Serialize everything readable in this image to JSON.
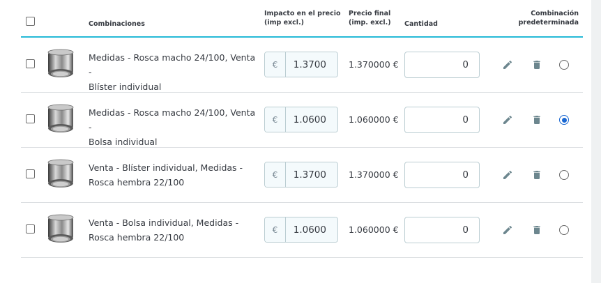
{
  "header": {
    "combinations": "Combinaciones",
    "impact_line1": "Impacto en el precio",
    "impact_line2": "(imp excl.)",
    "final_line1": "Precio final",
    "final_line2": "(imp. excl.)",
    "quantity": "Cantidad",
    "default_line1": "Combinación",
    "default_line2": "predeterminada"
  },
  "rows": [
    {
      "name_line1": "Medidas - Rosca macho 24/100, Venta -",
      "name_line2": "Blíster individual",
      "currency": "€",
      "impact": "1.3700",
      "final_price": "1.370000 €",
      "quantity": "0",
      "is_default": false,
      "image": "male-thread-aerator"
    },
    {
      "name_line1": "Medidas - Rosca macho 24/100, Venta -",
      "name_line2": "Bolsa individual",
      "currency": "€",
      "impact": "1.0600",
      "final_price": "1.060000 €",
      "quantity": "0",
      "is_default": true,
      "image": "male-thread-aerator"
    },
    {
      "name_line1": "Venta - Blíster individual, Medidas -",
      "name_line2": "Rosca hembra 22/100",
      "currency": "€",
      "impact": "1.3700",
      "final_price": "1.370000 €",
      "quantity": "0",
      "is_default": false,
      "image": "female-thread-aerator"
    },
    {
      "name_line1": "Venta - Bolsa individual, Medidas -",
      "name_line2": "Rosca hembra 22/100",
      "currency": "€",
      "impact": "1.0600",
      "final_price": "1.060000 €",
      "quantity": "0",
      "is_default": false,
      "image": "female-thread-aerator"
    }
  ],
  "icons": {
    "edit": "pencil-icon",
    "delete": "trash-icon"
  },
  "colors": {
    "accent": "#25b9d7",
    "radio_checked": "#1967d2",
    "icon": "#6c868e"
  }
}
